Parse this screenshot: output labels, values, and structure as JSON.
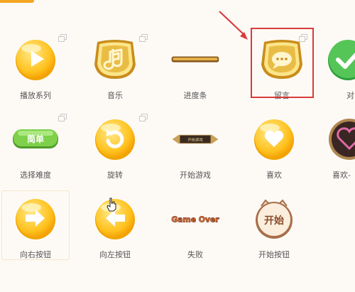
{
  "palette": {
    "background": "#fdfaf6",
    "accent": "#f5a623",
    "annotation_red": "#d93a3a",
    "label_text": "#555555"
  },
  "tiles": [
    {
      "label": "播放系列",
      "icon": "play-button-icon"
    },
    {
      "label": "音乐",
      "icon": "music-note-icon"
    },
    {
      "label": "进度条",
      "icon": "progress-bar-icon"
    },
    {
      "label": "留言",
      "icon": "message-bubble-icon"
    },
    {
      "label": "对",
      "icon": "checkmark-icon"
    },
    {
      "label": "选择难度",
      "icon": "difficulty-badge-icon",
      "badge_text": "简单"
    },
    {
      "label": "旋转",
      "icon": "rotate-icon"
    },
    {
      "label": "开始游戏",
      "icon": "start-game-banner-icon",
      "banner_text": "开始游戏"
    },
    {
      "label": "喜欢",
      "icon": "heart-icon"
    },
    {
      "label": "喜欢-",
      "icon": "heart-frame-icon"
    },
    {
      "label": "向右按钮",
      "icon": "arrow-right-icon"
    },
    {
      "label": "向左按钮",
      "icon": "arrow-left-icon"
    },
    {
      "label": "失败",
      "icon": "game-over-text-icon",
      "art_text": "Game Over"
    },
    {
      "label": "开始按钮",
      "icon": "start-button-icon",
      "button_text": "开始"
    }
  ],
  "annotations": {
    "highlight": "red-rectangle-around-留言",
    "arrow": "red-arrow-pointing-to-留言"
  }
}
